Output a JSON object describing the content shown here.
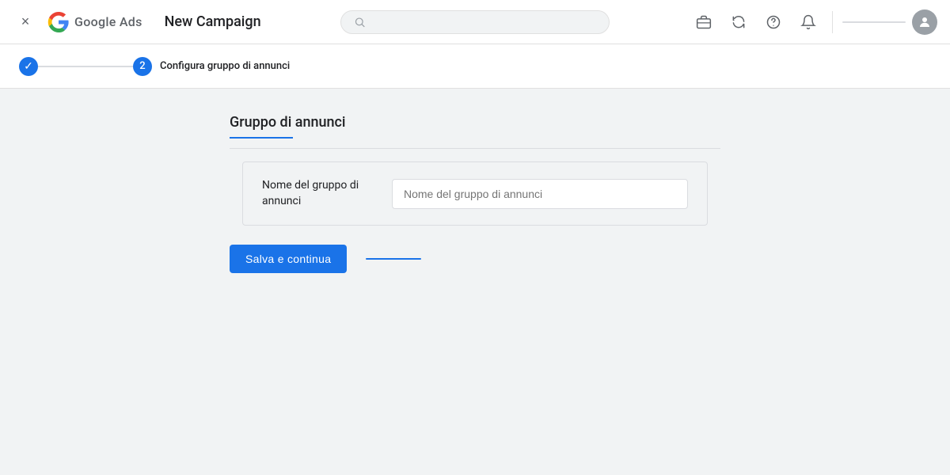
{
  "header": {
    "close_label": "×",
    "logo_text": "Google Ads",
    "campaign_title": "New Campaign",
    "search_placeholder": "",
    "account_line": "",
    "icons": {
      "briefcase": "💼",
      "refresh": "↻",
      "help": "?",
      "bell": "🔔"
    }
  },
  "progress": {
    "step1_done": "✓",
    "step1_line": "",
    "step2_number": "2",
    "step2_label": "Configura gruppo di annunci"
  },
  "main": {
    "section_title": "Gruppo di annunci",
    "form_label": "Nome del gruppo di annunci",
    "input_placeholder": "Nome del gruppo di annunci",
    "save_button": "Salva e continua"
  }
}
